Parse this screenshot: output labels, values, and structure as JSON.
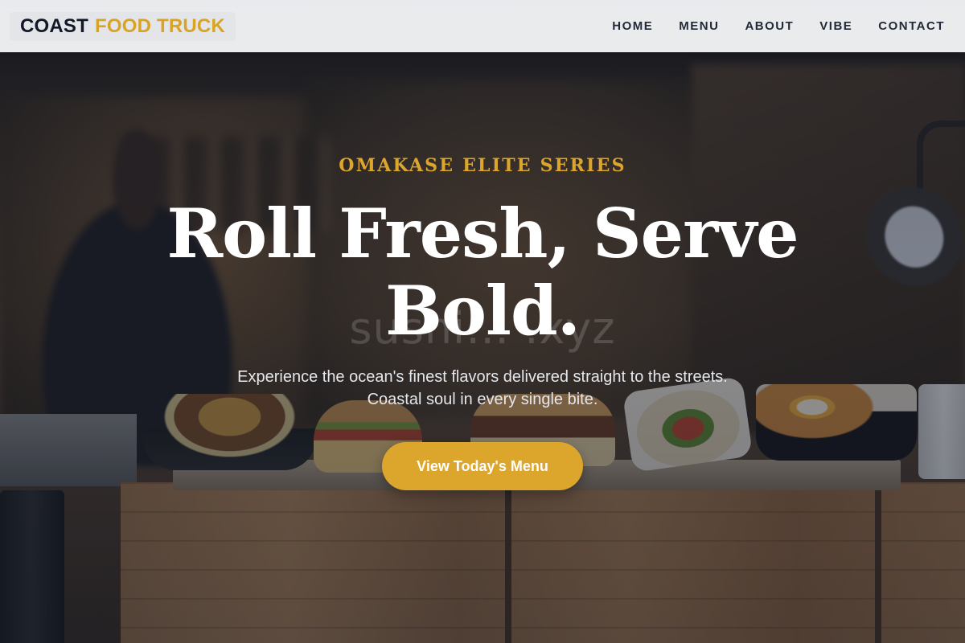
{
  "brand": {
    "part1": "COAST",
    "part2": "FOOD TRUCK"
  },
  "nav": {
    "items": [
      {
        "label": "HOME"
      },
      {
        "label": "MENU"
      },
      {
        "label": "ABOUT"
      },
      {
        "label": "VIBE"
      },
      {
        "label": "CONTACT"
      }
    ]
  },
  "hero": {
    "kicker": "OMAKASE ELITE SERIES",
    "headline_line1": "Roll Fresh, Serve",
    "headline_line2": "Bold.",
    "watermark": "sushi… .xyz",
    "lead_line1": "Experience the ocean's finest flavors delivered straight to the streets.",
    "lead_line2": "Coastal soul in every single bite.",
    "cta_label": "View Today's Menu"
  },
  "colors": {
    "accent": "#dca52b",
    "header_bg": "#f3f4f6",
    "text_dark": "#111827",
    "overlay": "#111827"
  }
}
